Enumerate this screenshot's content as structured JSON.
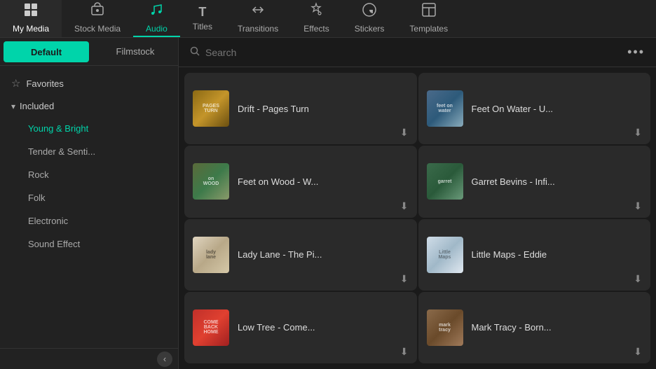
{
  "nav": {
    "items": [
      {
        "id": "my-media",
        "label": "My Media",
        "icon": "▦",
        "active": false
      },
      {
        "id": "stock-media",
        "label": "Stock Media",
        "icon": "☁",
        "active": false
      },
      {
        "id": "audio",
        "label": "Audio",
        "icon": "♪",
        "active": true
      },
      {
        "id": "titles",
        "label": "Titles",
        "icon": "T",
        "active": false
      },
      {
        "id": "transitions",
        "label": "Transitions",
        "icon": "↔",
        "active": false
      },
      {
        "id": "effects",
        "label": "Effects",
        "icon": "✦",
        "active": false
      },
      {
        "id": "stickers",
        "label": "Stickers",
        "icon": "◈",
        "active": false
      },
      {
        "id": "templates",
        "label": "Templates",
        "icon": "▣",
        "active": false
      }
    ]
  },
  "sidebar": {
    "tabs": [
      {
        "id": "default",
        "label": "Default",
        "active": true
      },
      {
        "id": "filmstock",
        "label": "Filmstock",
        "active": false
      }
    ],
    "sections": [
      {
        "id": "favorites",
        "label": "Favorites",
        "icon": "star"
      },
      {
        "id": "included",
        "label": "Included",
        "expanded": true,
        "items": [
          {
            "id": "young-bright",
            "label": "Young & Bright",
            "active": true
          },
          {
            "id": "tender",
            "label": "Tender & Senti...",
            "active": false
          },
          {
            "id": "rock",
            "label": "Rock",
            "active": false
          },
          {
            "id": "folk",
            "label": "Folk",
            "active": false
          },
          {
            "id": "electronic",
            "label": "Electronic",
            "active": false
          },
          {
            "id": "sound-effect",
            "label": "Sound Effect",
            "active": false
          }
        ]
      }
    ],
    "collapse_icon": "‹"
  },
  "search": {
    "placeholder": "Search",
    "more_icon": "•••"
  },
  "music_cards": [
    {
      "id": "drift",
      "title": "Drift - Pages Turn",
      "art_class": "art-drift",
      "art_text": "PAGES\nTURN"
    },
    {
      "id": "feet-on-water",
      "title": "Feet On Water - U...",
      "art_class": "art-feetonwater",
      "art_text": "feet on\nwater"
    },
    {
      "id": "feet-on-wood",
      "title": "Feet on Wood - W...",
      "art_class": "art-feetonwood",
      "art_text": "on\nWOOD"
    },
    {
      "id": "garret",
      "title": "Garret Bevins - Infi...",
      "art_class": "art-garret",
      "art_text": "garret"
    },
    {
      "id": "lady-lane",
      "title": "Lady Lane - The Pi...",
      "art_class": "art-ladylane",
      "art_text": "lady\nlane"
    },
    {
      "id": "little-maps",
      "title": "Little Maps - Eddie",
      "art_class": "art-littlemaps",
      "art_text": "Little\nMaps"
    },
    {
      "id": "low-tree",
      "title": "Low Tree - Come...",
      "art_class": "art-lowtree",
      "art_text": "COME\nBACK\nHOME"
    },
    {
      "id": "mark-tracy",
      "title": "Mark Tracy - Born...",
      "art_class": "art-marktracy",
      "art_text": "mark\ntracy"
    }
  ],
  "download_icon": "⬇"
}
